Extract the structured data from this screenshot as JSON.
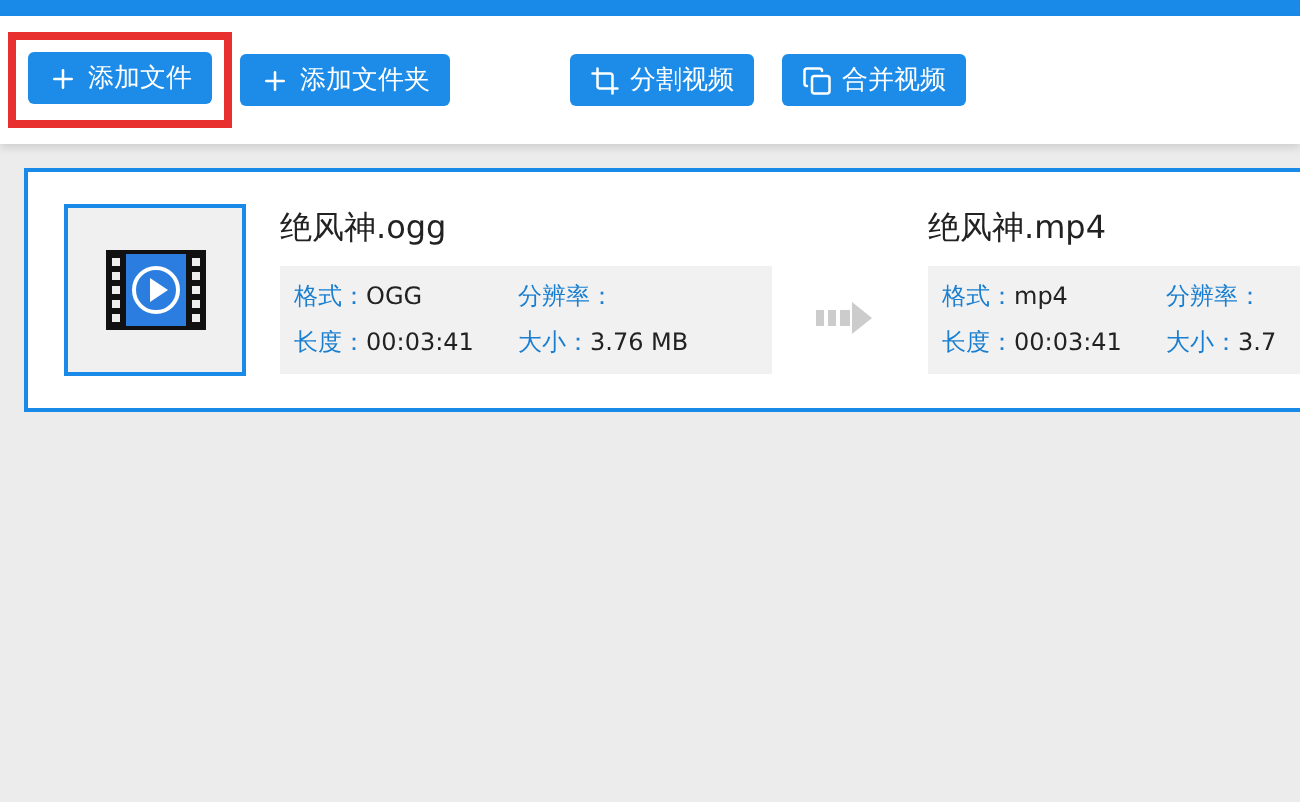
{
  "toolbar": {
    "buttons": [
      {
        "label": "添加文件",
        "highlighted": true
      },
      {
        "label": "添加文件夹",
        "highlighted": false
      },
      {
        "label": "分割视频",
        "highlighted": false
      },
      {
        "label": "合并视频",
        "highlighted": false
      }
    ]
  },
  "task": {
    "source": {
      "name": "绝风神.ogg",
      "fields": [
        {
          "label": "格式：",
          "value": "OGG"
        },
        {
          "label": "分辨率："
        },
        {
          "label": "长度：",
          "value": "00:03:41"
        },
        {
          "label": "大小：",
          "value": "3.76 MB"
        }
      ]
    },
    "target": {
      "name": "绝风神.mp4",
      "fields": [
        {
          "label": "格式：",
          "value": "mp4"
        },
        {
          "label": "分辨率："
        },
        {
          "label": "长度：",
          "value": "00:03:41"
        },
        {
          "label": "大小：",
          "value": "3.7"
        }
      ]
    }
  }
}
